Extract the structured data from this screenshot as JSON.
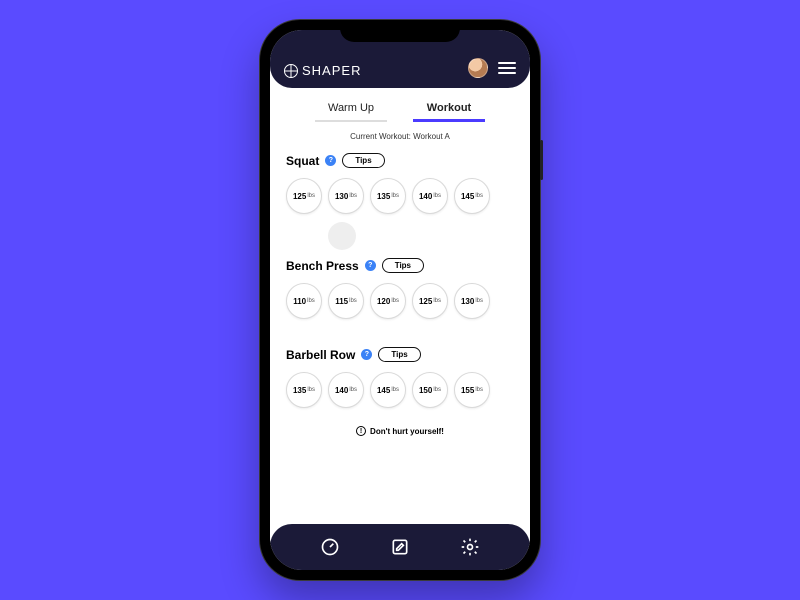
{
  "brand": "SHAPER",
  "tabs": {
    "warmup": "Warm Up",
    "workout": "Workout",
    "active": "workout"
  },
  "subtitle": "Current Workout: Workout A",
  "tips_label": "Tips",
  "unit": "lbs",
  "exercises": [
    {
      "name": "Squat",
      "sets": [
        125,
        130,
        135,
        140,
        145
      ]
    },
    {
      "name": "Bench Press",
      "sets": [
        110,
        115,
        120,
        125,
        130
      ]
    },
    {
      "name": "Barbell Row",
      "sets": [
        135,
        140,
        145,
        150,
        155
      ]
    }
  ],
  "warning": "Don't hurt yourself!"
}
